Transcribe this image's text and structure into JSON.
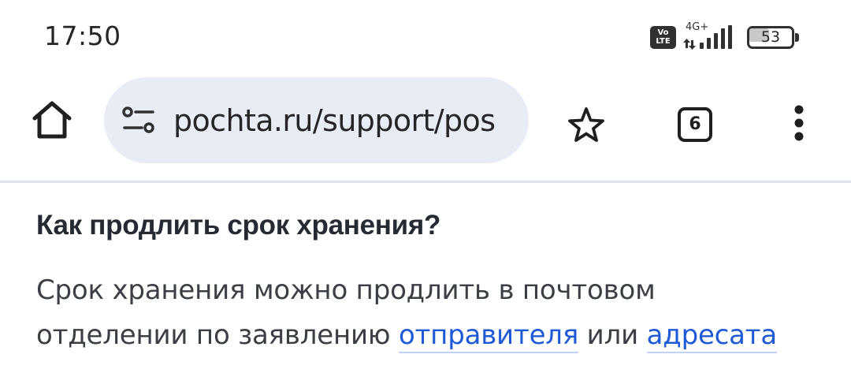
{
  "status_bar": {
    "time": "17:50",
    "volte_top": "Vo",
    "volte_bottom": "LTE",
    "network_type": "4G+",
    "battery_level": "53",
    "battery_fraction": 0.53,
    "signal_icon": "signal-bars-icon"
  },
  "toolbar": {
    "home_icon": "home-icon",
    "site_settings_icon": "tune-icon",
    "url": "pochta.ru/support/pos",
    "bookmark_icon": "star-outline-icon",
    "tab_count": "6",
    "menu_icon": "more-vert-icon"
  },
  "article": {
    "heading": "Как продлить срок хранения?",
    "body_line1": "Срок хранения можно продлить в почтовом",
    "body_line2_before": "отделении по заявлению ",
    "link_sender": "отправителя",
    "body_line2_middle": " или ",
    "link_recipient": "адресата"
  },
  "colors": {
    "omnibox_bg": "#e8ecf5",
    "link": "#1e5ad6",
    "heading": "#262b33",
    "body_text": "#3b3f45",
    "divider": "#dde3ea"
  }
}
